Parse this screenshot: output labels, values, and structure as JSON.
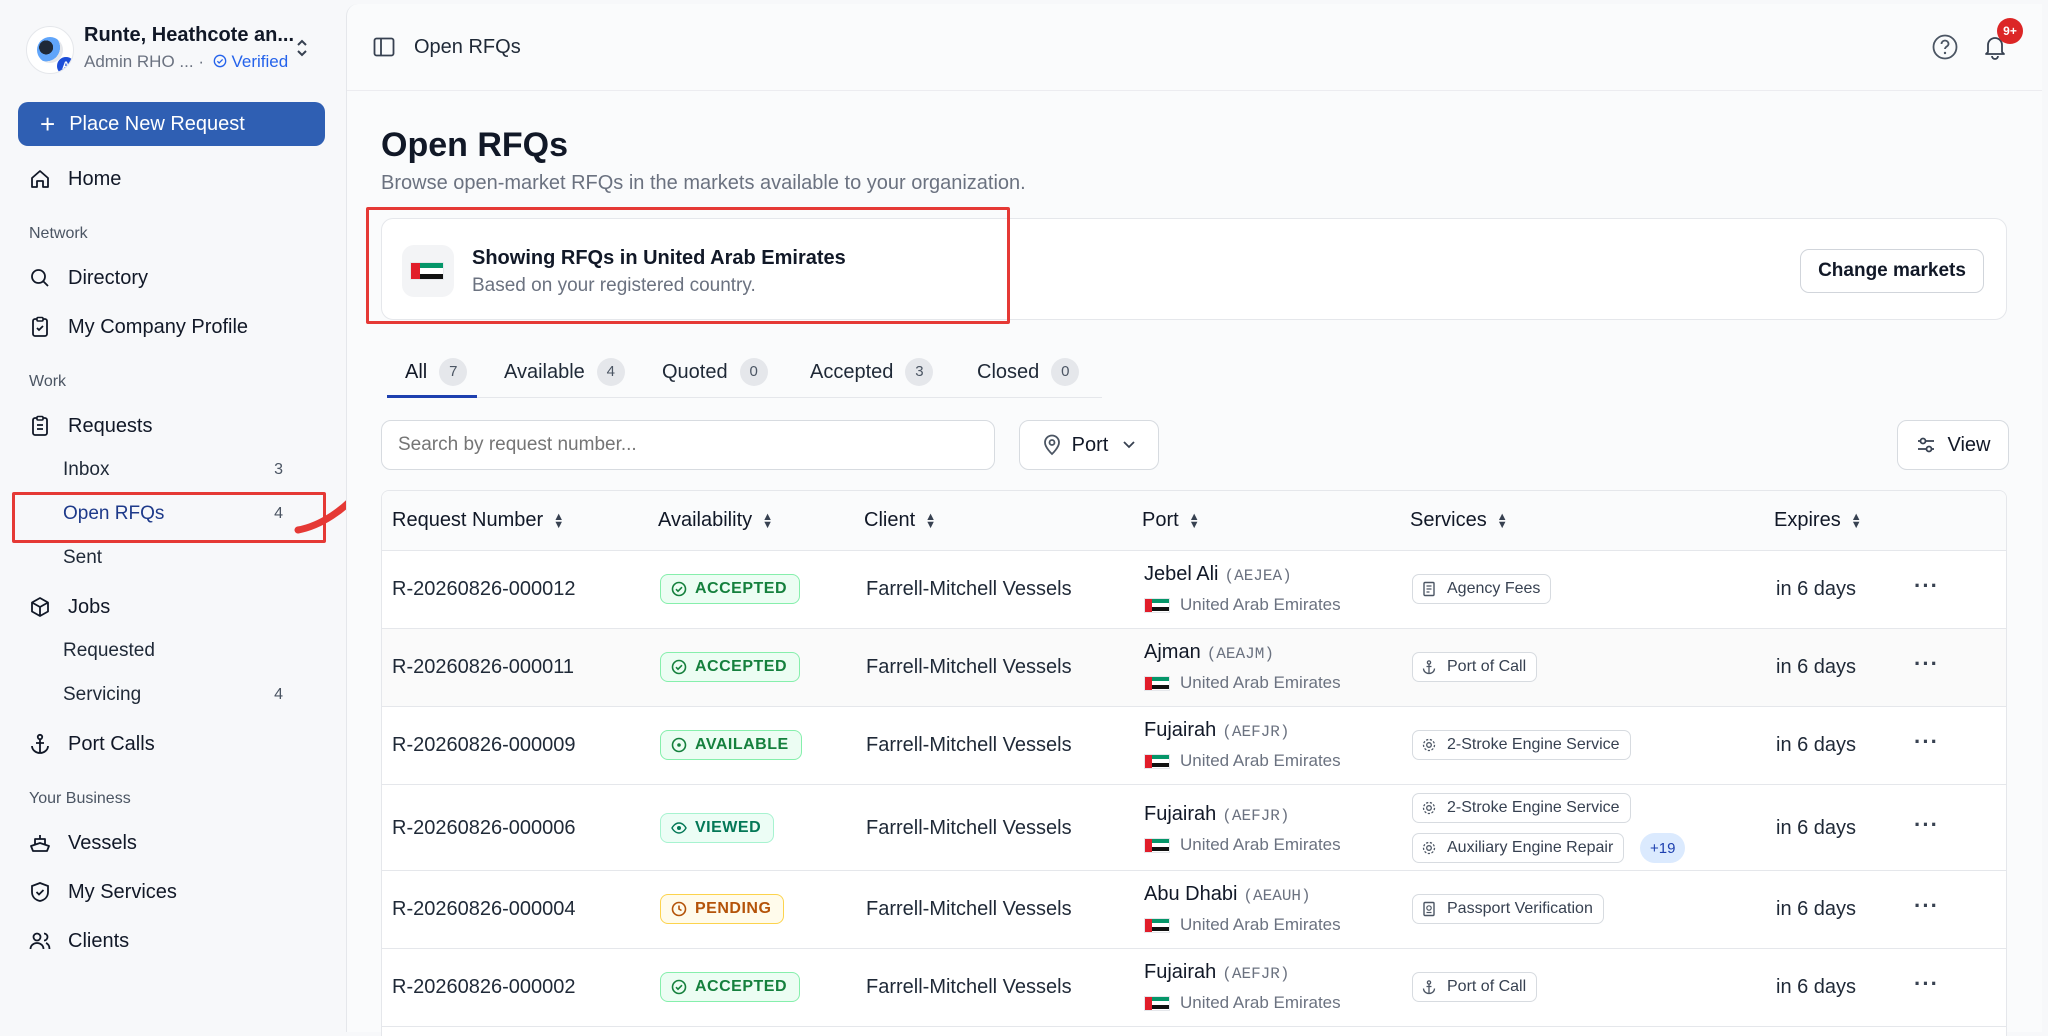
{
  "org": {
    "name": "Runte, Heathcote an...",
    "role": "Admin RHO ...",
    "separator": "·",
    "verified": "Verified",
    "badge_letter": "A"
  },
  "sidebar": {
    "place_request": "Place New Request",
    "home": "Home",
    "section_network": "Network",
    "directory": "Directory",
    "company_profile": "My Company Profile",
    "section_work": "Work",
    "requests": "Requests",
    "inbox": "Inbox",
    "inbox_count": "3",
    "open_rfqs": "Open RFQs",
    "open_rfqs_count": "4",
    "sent": "Sent",
    "jobs": "Jobs",
    "requested": "Requested",
    "servicing": "Servicing",
    "servicing_count": "4",
    "port_calls": "Port Calls",
    "section_business": "Your Business",
    "vessels": "Vessels",
    "my_services": "My Services",
    "clients": "Clients"
  },
  "topbar": {
    "title": "Open RFQs",
    "notif_badge": "9+"
  },
  "page": {
    "title": "Open RFQs",
    "subtitle": "Browse open-market RFQs in the markets available to your organization."
  },
  "market": {
    "title": "Showing RFQs in United Arab Emirates",
    "subtitle": "Based on your registered country.",
    "change_button": "Change markets"
  },
  "tabs": [
    {
      "label": "All",
      "count": "7"
    },
    {
      "label": "Available",
      "count": "4"
    },
    {
      "label": "Quoted",
      "count": "0"
    },
    {
      "label": "Accepted",
      "count": "3"
    },
    {
      "label": "Closed",
      "count": "0"
    }
  ],
  "filters": {
    "search_placeholder": "Search by request number...",
    "port": "Port",
    "view": "View"
  },
  "table": {
    "headers": [
      "Request Number",
      "Availability",
      "Client",
      "Port",
      "Services",
      "Expires"
    ],
    "rows": [
      {
        "req": "R-20260826-000012",
        "status": "ACCEPTED",
        "client": "Farrell-Mitchell Vessels",
        "port": "Jebel Ali",
        "code": "(AEJEA)",
        "country": "United Arab Emirates",
        "services": [
          "Agency Fees"
        ],
        "more": "",
        "expires": "in 6 days"
      },
      {
        "req": "R-20260826-000011",
        "status": "ACCEPTED",
        "client": "Farrell-Mitchell Vessels",
        "port": "Ajman",
        "code": "(AEAJM)",
        "country": "United Arab Emirates",
        "services": [
          "Port of Call"
        ],
        "more": "",
        "expires": "in 6 days"
      },
      {
        "req": "R-20260826-000009",
        "status": "AVAILABLE",
        "client": "Farrell-Mitchell Vessels",
        "port": "Fujairah",
        "code": "(AEFJR)",
        "country": "United Arab Emirates",
        "services": [
          "2-Stroke Engine Service"
        ],
        "more": "",
        "expires": "in 6 days"
      },
      {
        "req": "R-20260826-000006",
        "status": "VIEWED",
        "client": "Farrell-Mitchell Vessels",
        "port": "Fujairah",
        "code": "(AEFJR)",
        "country": "United Arab Emirates",
        "services": [
          "2-Stroke Engine Service",
          "Auxiliary Engine Repair"
        ],
        "more": "+19",
        "expires": "in 6 days"
      },
      {
        "req": "R-20260826-000004",
        "status": "PENDING",
        "client": "Farrell-Mitchell Vessels",
        "port": "Abu Dhabi",
        "code": "(AEAUH)",
        "country": "United Arab Emirates",
        "services": [
          "Passport Verification"
        ],
        "more": "",
        "expires": "in 6 days"
      },
      {
        "req": "R-20260826-000002",
        "status": "ACCEPTED",
        "client": "Farrell-Mitchell Vessels",
        "port": "Fujairah",
        "code": "(AEFJR)",
        "country": "United Arab Emirates",
        "services": [
          "Port of Call"
        ],
        "more": "",
        "expires": "in 6 days"
      }
    ]
  },
  "colors": {
    "accent": "#2f5fb3",
    "highlight": "#e53935",
    "accepted": "#15803d",
    "pending": "#b45309",
    "notif": "#dc2626"
  }
}
